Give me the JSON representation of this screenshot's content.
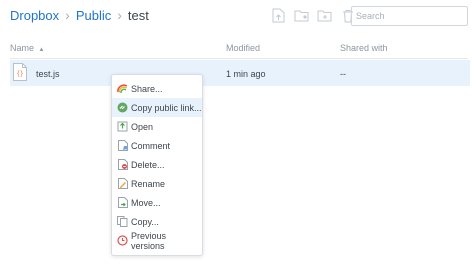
{
  "breadcrumb": {
    "items": [
      "Dropbox",
      "Public"
    ],
    "current": "test",
    "separator": "›"
  },
  "toolbar": {
    "icons": [
      "upload-icon",
      "new-shared-folder-icon",
      "new-folder-icon",
      "delete-icon"
    ]
  },
  "search": {
    "placeholder": "Search",
    "value": ""
  },
  "table": {
    "columns": {
      "name": "Name",
      "sort_indicator": "▲",
      "modified": "Modified",
      "shared_with": "Shared with"
    },
    "rows": [
      {
        "name": "test.js",
        "icon": "js-file-icon",
        "modified": "1 min ago",
        "shared_with": "--"
      }
    ]
  },
  "context_menu": {
    "items": [
      {
        "label": "Share...",
        "icon": "share-icon"
      },
      {
        "label": "Copy public link...",
        "icon": "link-icon",
        "highlighted": true
      },
      {
        "label": "Open",
        "icon": "open-icon"
      },
      {
        "label": "Comment",
        "icon": "comment-icon"
      },
      {
        "label": "Delete...",
        "icon": "delete-icon"
      },
      {
        "label": "Rename",
        "icon": "rename-icon"
      },
      {
        "label": "Move...",
        "icon": "move-icon"
      },
      {
        "label": "Copy...",
        "icon": "copy-icon"
      },
      {
        "label": "Previous versions",
        "icon": "history-icon"
      }
    ]
  },
  "colors": {
    "link": "#1f75cc",
    "row_selected": "#e8f2fd",
    "text": "#3d464d",
    "muted": "#8d979f"
  }
}
